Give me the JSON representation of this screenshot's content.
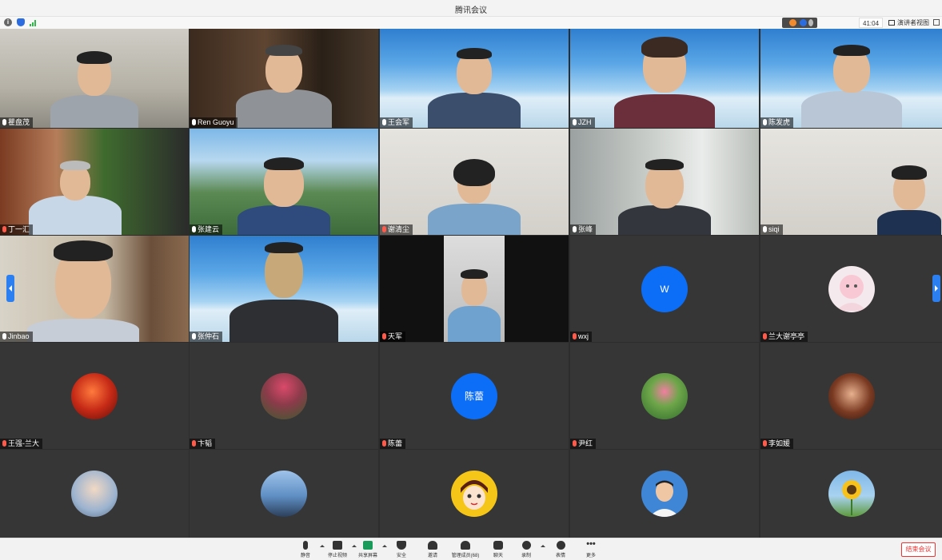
{
  "window": {
    "title": "腾讯会议"
  },
  "info": {
    "timer": "41:04",
    "view_label": "演讲者视图"
  },
  "tiles": [
    {
      "name": "瞿盘茂",
      "muted": false
    },
    {
      "name": "Ren Guoyu",
      "muted": false
    },
    {
      "name": "王会军",
      "muted": false
    },
    {
      "name": "JZH",
      "muted": false
    },
    {
      "name": "陈发虎",
      "muted": false
    },
    {
      "name": "丁一汇",
      "muted": true
    },
    {
      "name": "张建云",
      "muted": false
    },
    {
      "name": "谢清尘",
      "muted": true
    },
    {
      "name": "张峰",
      "muted": false
    },
    {
      "name": "siqi",
      "muted": false
    },
    {
      "name": "Jinbao",
      "muted": false
    },
    {
      "name": "张仲石",
      "muted": false
    },
    {
      "name": "天军",
      "muted": true
    },
    {
      "name": "wxj",
      "muted": true,
      "avatar_text": "W"
    },
    {
      "name": "兰大谢亭亭",
      "muted": true
    },
    {
      "name": "王强-兰大",
      "muted": true
    },
    {
      "name": "卞韬",
      "muted": true
    },
    {
      "name": "陈蕾",
      "muted": true,
      "avatar_text": "陈蕾"
    },
    {
      "name": "尹红",
      "muted": true
    },
    {
      "name": "李如媛",
      "muted": true
    }
  ],
  "toolbar": {
    "mute": "静音",
    "stop_video": "停止视频",
    "share_screen": "共享屏幕",
    "security": "安全",
    "invite": "邀请",
    "manage_members": "管理成员(68)",
    "chat": "聊天",
    "record": "录制",
    "reactions": "表情",
    "more": "更多",
    "end_meeting": "结束会议"
  },
  "colors": {
    "accent": "#0c6ef6",
    "end_button": "#ee3333",
    "grid_bg": "#2d2d2d"
  }
}
